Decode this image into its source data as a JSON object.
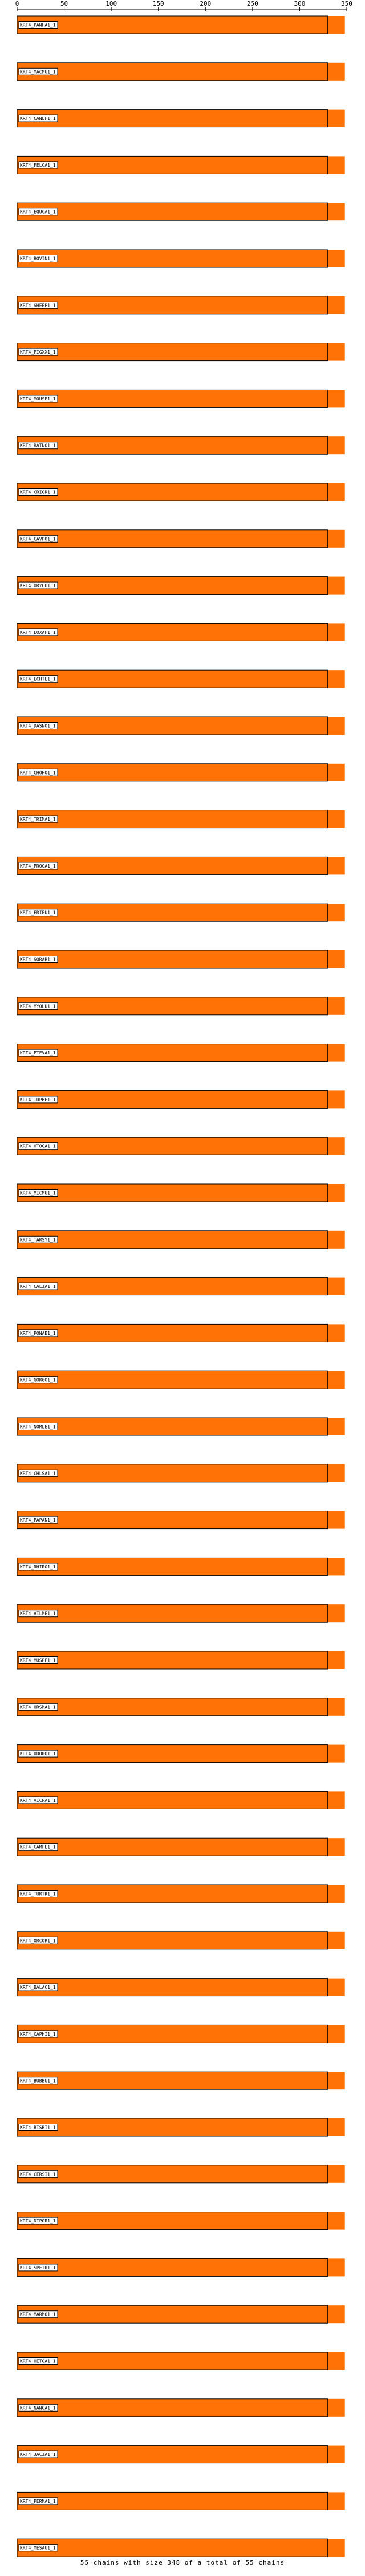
{
  "chart_data": {
    "type": "bar",
    "xlim": [
      0,
      350
    ],
    "ticks": [
      "0",
      "50",
      "100",
      "150",
      "200",
      "250",
      "300",
      "350"
    ],
    "bar_color": "#ff7205",
    "label_box_color": "#ff7205",
    "categories": [
      "KRT4_PANHA1_1",
      "KRT4_MACMU1_1",
      "KRT4_CANLF1_1",
      "KRT4_FELCA1_1",
      "KRT4_EQUCA1_1",
      "KRT4_BOVIN1_1",
      "KRT4_SHEEP1_1",
      "KRT4_PIGXX1_1",
      "KRT4_MOUSE1_1",
      "KRT4_RATNO1_1",
      "KRT4_CRIGR1_1",
      "KRT4_CAVPO1_1",
      "KRT4_ORYCU1_1",
      "KRT4_LOXAF1_1",
      "KRT4_ECHTE1_1",
      "KRT4_DASNO1_1",
      "KRT4_CHOHO1_1",
      "KRT4_TRIMA1_1",
      "KRT4_PROCA1_1",
      "KRT4_ERIEU1_1",
      "KRT4_SORAR1_1",
      "KRT4_MYOLU1_1",
      "KRT4_PTEVA1_1",
      "KRT4_TUPBE1_1",
      "KRT4_OTOGA1_1",
      "KRT4_MICMU1_1",
      "KRT4_TARSY1_1",
      "KRT4_CALJA1_1",
      "KRT4_PONAB1_1",
      "KRT4_GORGO1_1",
      "KRT4_NOMLE1_1",
      "KRT4_CHLSA1_1",
      "KRT4_PAPAN1_1",
      "KRT4_RHIRO1_1",
      "KRT4_AILME1_1",
      "KRT4_MUSPF1_1",
      "KRT4_URSMA1_1",
      "KRT4_ODORO1_1",
      "KRT4_VICPA1_1",
      "KRT4_CAMFE1_1",
      "KRT4_TURTR1_1",
      "KRT4_ORCOR1_1",
      "KRT4_BALAC1_1",
      "KRT4_CAPHI1_1",
      "KRT4_BUBBU1_1",
      "KRT4_BISBI1_1",
      "KRT4_CERSI1_1",
      "KRT4_DIPOR1_1",
      "KRT4_SPETR1_1",
      "KRT4_MARMO1_1",
      "KRT4_HETGA1_1",
      "KRT4_NANGA1_1",
      "KRT4_JACJA1_1",
      "KRT4_PERMA1_1",
      "KRT4_MESAU1_1"
    ],
    "values": [
      348,
      348,
      348,
      348,
      348,
      348,
      348,
      348,
      348,
      348,
      348,
      348,
      348,
      348,
      348,
      348,
      348,
      348,
      348,
      348,
      348,
      348,
      348,
      348,
      348,
      348,
      348,
      348,
      348,
      348,
      348,
      348,
      348,
      348,
      348,
      348,
      348,
      348,
      348,
      348,
      348,
      348,
      348,
      348,
      348,
      348,
      348,
      348,
      348,
      348,
      348,
      348,
      348,
      348,
      348
    ],
    "footer": "55 chains with size 348 of a total of 55 chains"
  }
}
